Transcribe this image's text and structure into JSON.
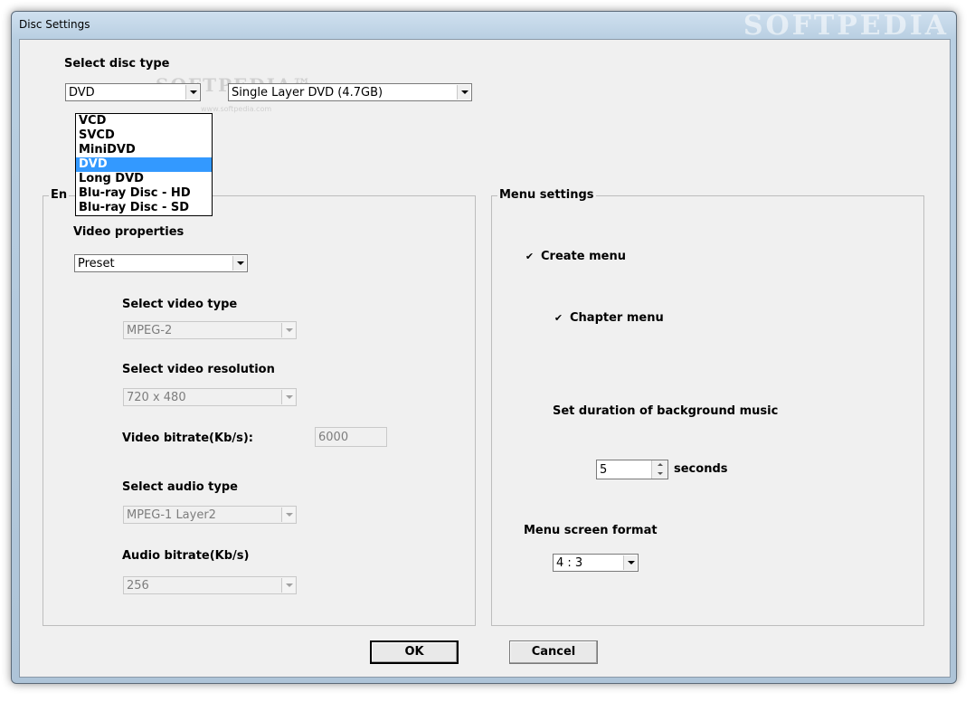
{
  "window": {
    "title": "Disc Settings",
    "watermark": "SOFTPEDIA",
    "client_watermark": "SOFTPEDIA™",
    "client_watermark_url": "www.softpedia.com"
  },
  "disc": {
    "label": "Select disc type",
    "type_value": "DVD",
    "capacity_value": "Single Layer DVD (4.7GB)",
    "options": [
      "VCD",
      "SVCD",
      "MiniDVD",
      "DVD",
      "Long DVD",
      "Blu-ray Disc - HD",
      "Blu-ray Disc - SD"
    ],
    "selected_index": 3
  },
  "encoding": {
    "group_title": "En",
    "video_properties_label": "Video properties",
    "video_properties_value": "Preset",
    "video_type_label": "Select video type",
    "video_type_value": "MPEG-2",
    "video_resolution_label": "Select video resolution",
    "video_resolution_value": "720 x 480",
    "video_bitrate_label": "Video bitrate(Kb/s):",
    "video_bitrate_value": "6000",
    "audio_type_label": "Select audio type",
    "audio_type_value": "MPEG-1 Layer2",
    "audio_bitrate_label": "Audio bitrate(Kb/s)",
    "audio_bitrate_value": "256"
  },
  "menu": {
    "group_title": "Menu settings",
    "create_menu_label": "Create menu",
    "create_menu_checked": true,
    "chapter_menu_label": "Chapter menu",
    "chapter_menu_checked": true,
    "bg_music_label": "Set duration of background music",
    "bg_music_value": "5",
    "bg_music_unit": "seconds",
    "screen_format_label": "Menu screen format",
    "screen_format_value": "4 : 3"
  },
  "buttons": {
    "ok": "OK",
    "cancel": "Cancel"
  },
  "checkmark_glyph": "✔"
}
